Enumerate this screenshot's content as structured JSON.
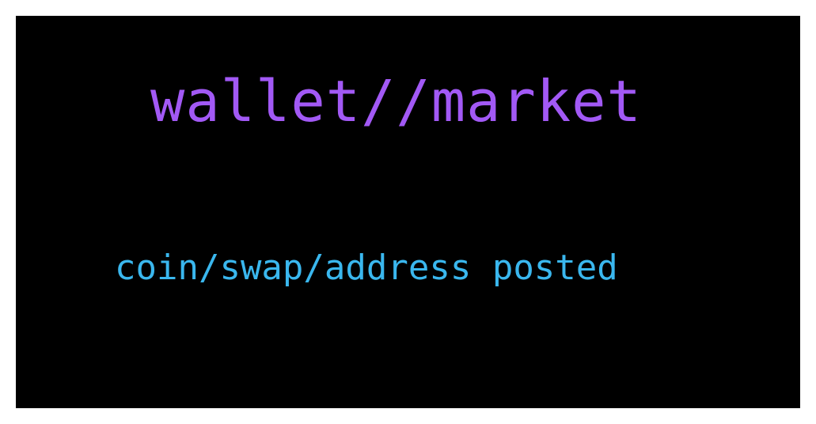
{
  "screen": {
    "title": "wallet//market",
    "status_message": "coin/swap/address posted"
  },
  "colors": {
    "background": "#000000",
    "frame": "#ffffff",
    "title": "#a259f5",
    "status": "#3ab7ee"
  }
}
